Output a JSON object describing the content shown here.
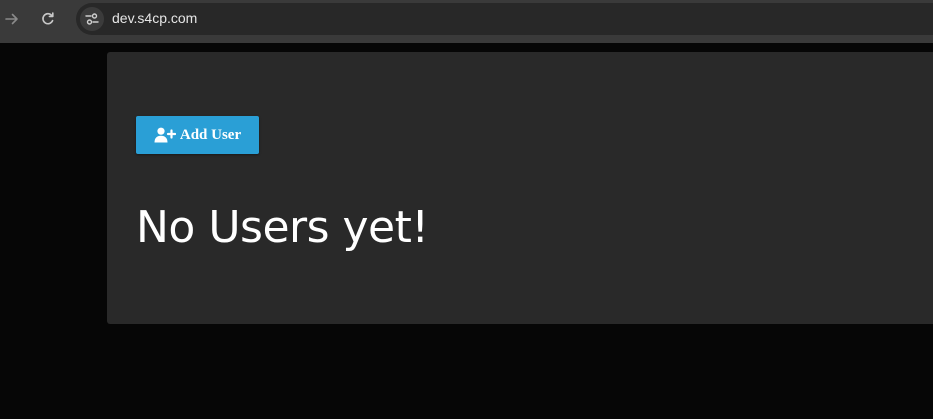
{
  "browser": {
    "url": "dev.s4cp.com",
    "icons": {
      "back": "arrow-right-icon",
      "reload": "reload-icon",
      "site_info": "tune-icon"
    }
  },
  "main": {
    "add_user_label": "Add User",
    "add_user_icon": "user-plus-icon",
    "empty_message": "No Users yet!"
  },
  "colors": {
    "page_background": "#060606",
    "card_background": "#292929",
    "button_background": "#2a9fd6",
    "toolbar_background": "#3a3a3a",
    "omnibox_background": "#282828"
  }
}
